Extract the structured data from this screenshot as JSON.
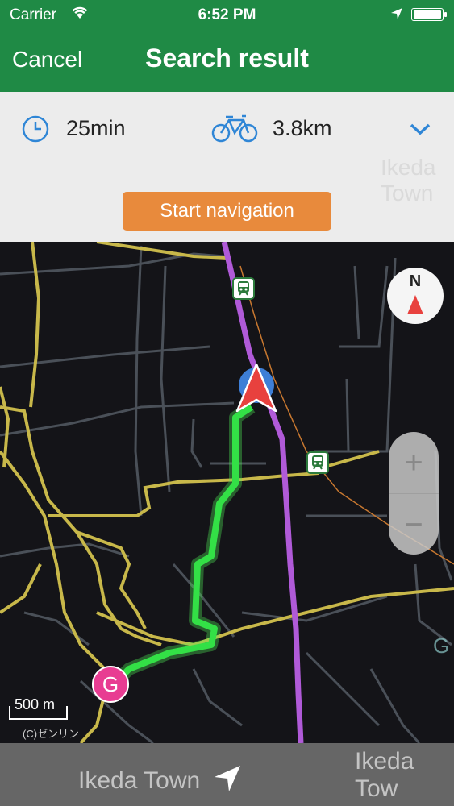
{
  "status_bar": {
    "carrier": "Carrier",
    "time": "6:52 PM"
  },
  "nav": {
    "cancel_label": "Cancel",
    "title": "Search result"
  },
  "summary": {
    "duration": "25min",
    "distance": "3.8km",
    "start_button": "Start navigation"
  },
  "map": {
    "compass_label": "N",
    "zoom_in": "+",
    "zoom_out": "−",
    "scale_label": "500 m",
    "copyright": "(C)ゼンリン",
    "goal_marker": "G",
    "labels": {
      "town_top": "Ikeda Town",
      "g_label": "G"
    },
    "colors": {
      "route": "#33e046",
      "rail": "#b05ad8",
      "roads": "#c8b84a",
      "background": "#141418"
    }
  },
  "bottom": {
    "town": "Ikeda Town",
    "town_right": "Ikeda Tow"
  }
}
